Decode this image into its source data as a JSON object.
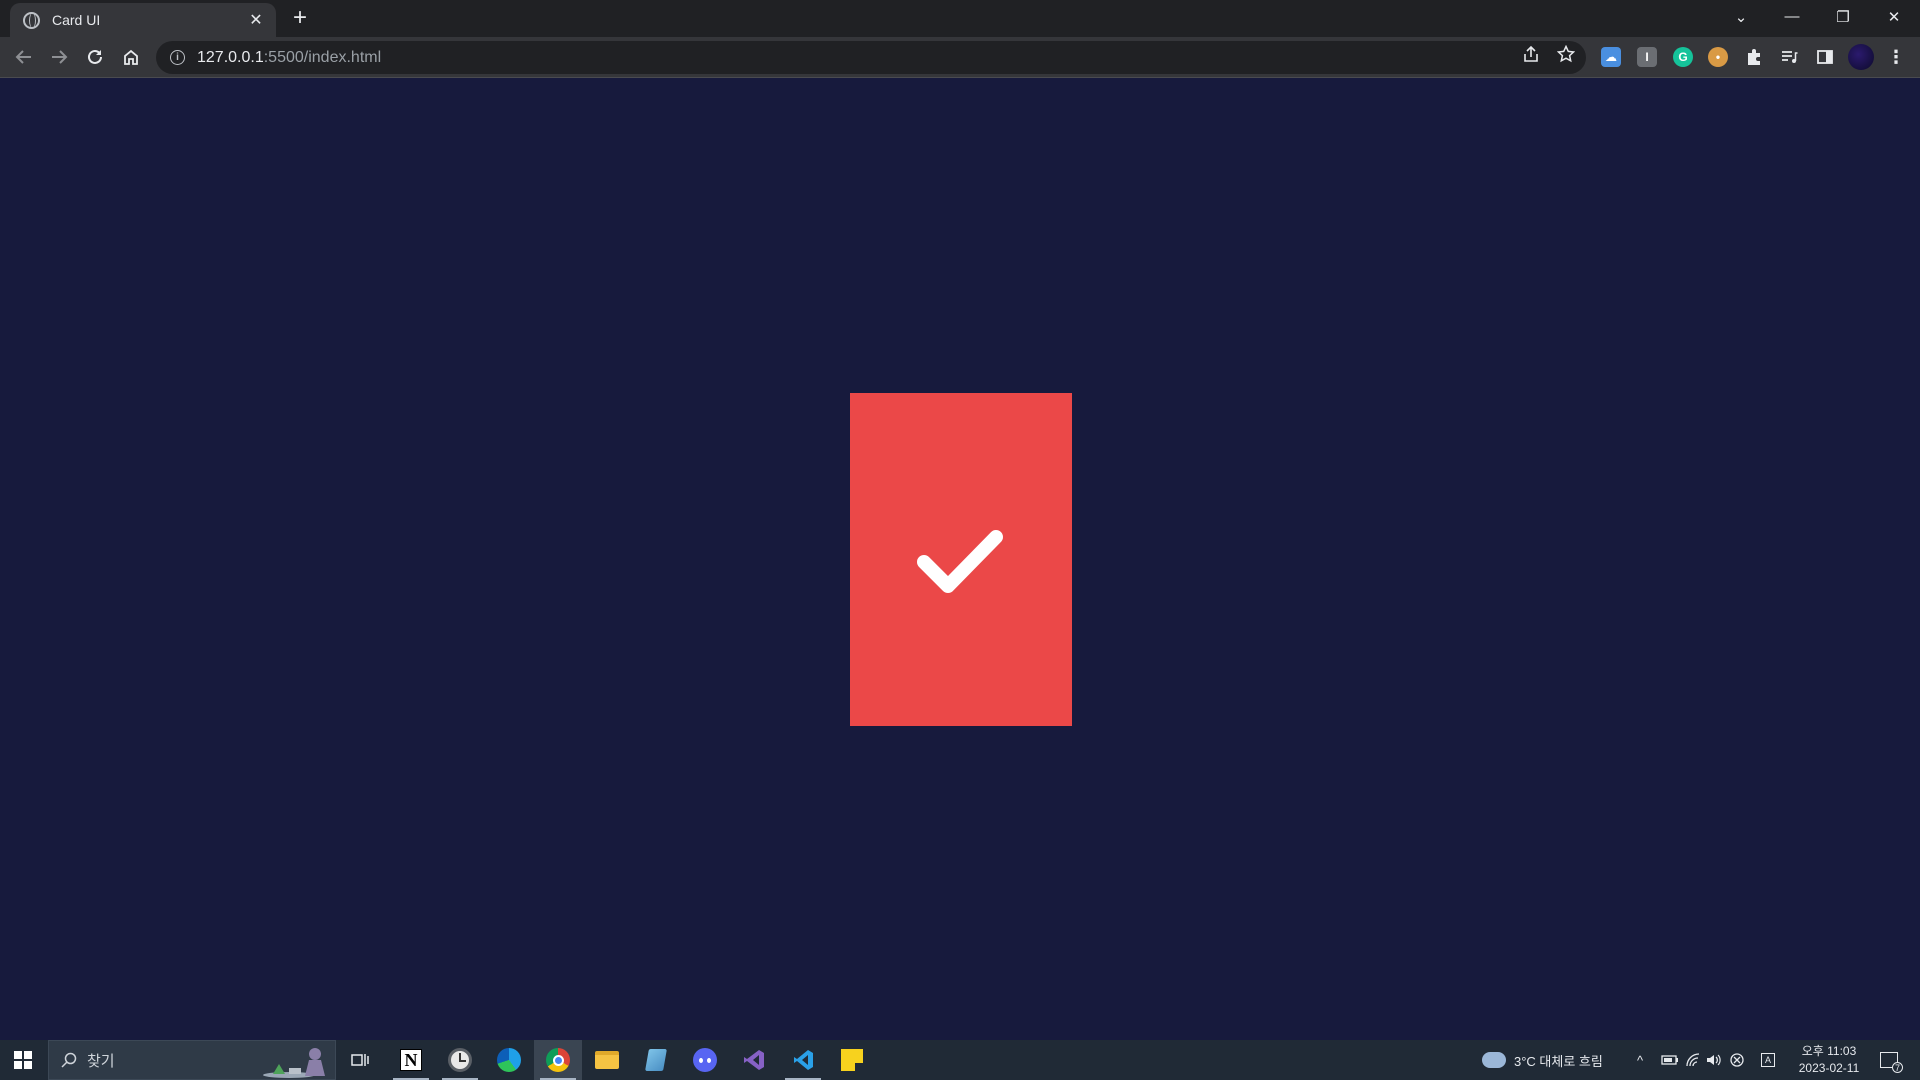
{
  "browser": {
    "tab_title": "Card UI",
    "tab_close": "✕",
    "new_tab": "+",
    "url_host": "127.0.0.1",
    "url_path": ":5500/index.html",
    "window_controls": [
      "⌄",
      "—",
      "❐",
      "✕"
    ]
  },
  "page": {
    "background": "#171a3d",
    "card_color": "#eb4848",
    "card_icon": "checkmark-icon"
  },
  "taskbar": {
    "search_placeholder": "찾기",
    "weather": "3°C  대체로 흐림",
    "time": "오후 11:03",
    "date": "2023-02-11",
    "notification_count": "7"
  }
}
